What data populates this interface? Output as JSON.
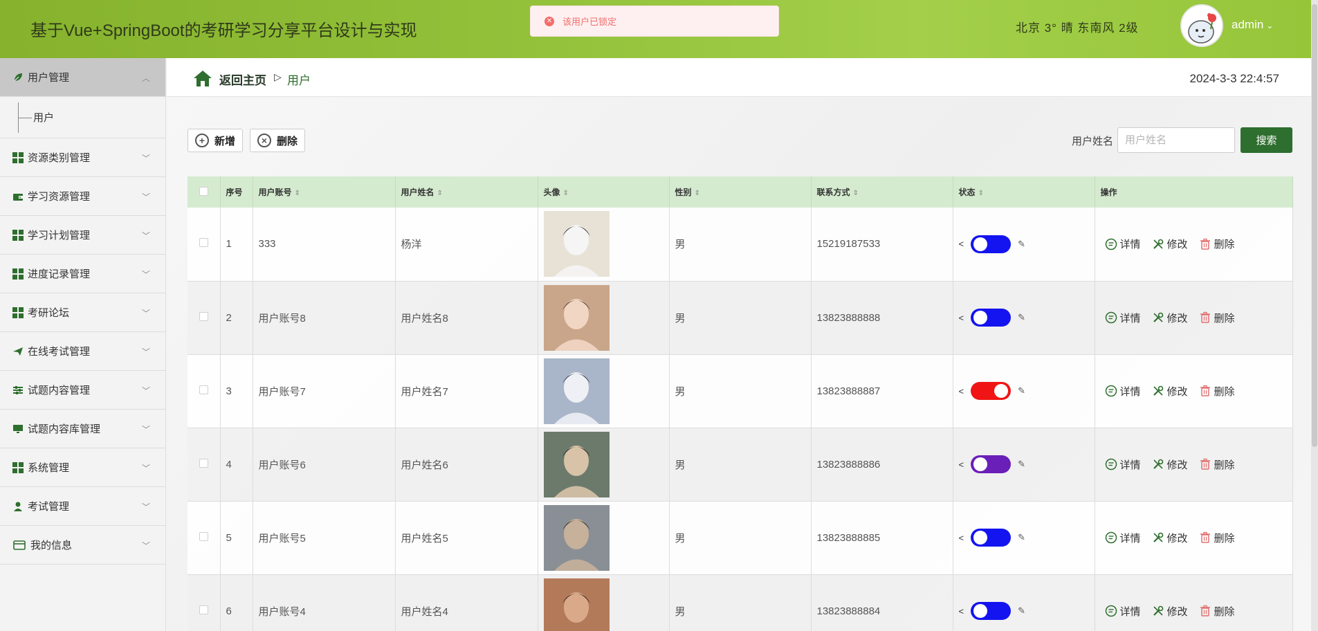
{
  "app": {
    "title": "基于Vue+SpringBoot的考研学习分享平台设计与实现",
    "weather": "北京  3°  晴  东南风  2级",
    "user": "admin"
  },
  "toast": {
    "message": "该用户已锁定",
    "color": "#f56c6c"
  },
  "sidebar": {
    "items": [
      {
        "label": "用户管理",
        "icon": "leaf-icon",
        "expanded": true
      },
      {
        "label": "资源类别管理",
        "icon": "grid-icon"
      },
      {
        "label": "学习资源管理",
        "icon": "wallet-icon"
      },
      {
        "label": "学习计划管理",
        "icon": "grid-icon"
      },
      {
        "label": "进度记录管理",
        "icon": "grid-icon"
      },
      {
        "label": "考研论坛",
        "icon": "grid-icon"
      },
      {
        "label": "在线考试管理",
        "icon": "send-icon"
      },
      {
        "label": "试题内容管理",
        "icon": "sliders-icon"
      },
      {
        "label": "试题内容库管理",
        "icon": "monitor-icon"
      },
      {
        "label": "系统管理",
        "icon": "grid-icon"
      },
      {
        "label": "考试管理",
        "icon": "person-icon"
      },
      {
        "label": "我的信息",
        "icon": "card-icon"
      }
    ],
    "sub_item": "用户"
  },
  "breadcrumb": {
    "home": "返回主页",
    "separator": "▷",
    "current": "用户"
  },
  "datetime": "2024-3-3 22:4:57",
  "toolbar": {
    "add_label": "新增",
    "delete_label": "删除"
  },
  "search": {
    "label": "用户姓名",
    "placeholder": "用户姓名",
    "button": "搜索"
  },
  "table": {
    "headers": [
      "序号",
      "用户账号",
      "用户姓名",
      "头像",
      "性别",
      "联系方式",
      "状态",
      "操作"
    ],
    "ops": {
      "detail": "详情",
      "edit": "修改",
      "delete": "删除"
    },
    "rows": [
      {
        "no": "1",
        "account": "333",
        "name": "杨洋",
        "gender": "男",
        "phone": "15219187533",
        "toggle_color": "#1414f0",
        "toggle_on": false
      },
      {
        "no": "2",
        "account": "用户账号8",
        "name": "用户姓名8",
        "gender": "男",
        "phone": "13823888888",
        "toggle_color": "#1414f0",
        "toggle_on": false
      },
      {
        "no": "3",
        "account": "用户账号7",
        "name": "用户姓名7",
        "gender": "男",
        "phone": "13823888887",
        "toggle_color": "#f01414",
        "toggle_on": true
      },
      {
        "no": "4",
        "account": "用户账号6",
        "name": "用户姓名6",
        "gender": "男",
        "phone": "13823888886",
        "toggle_color": "#6a1fb8",
        "toggle_on": false
      },
      {
        "no": "5",
        "account": "用户账号5",
        "name": "用户姓名5",
        "gender": "男",
        "phone": "13823888885",
        "toggle_color": "#1414f0",
        "toggle_on": false
      },
      {
        "no": "6",
        "account": "用户账号4",
        "name": "用户姓名4",
        "gender": "男",
        "phone": "13823888884",
        "toggle_color": "#1414f0",
        "toggle_on": false
      }
    ]
  }
}
